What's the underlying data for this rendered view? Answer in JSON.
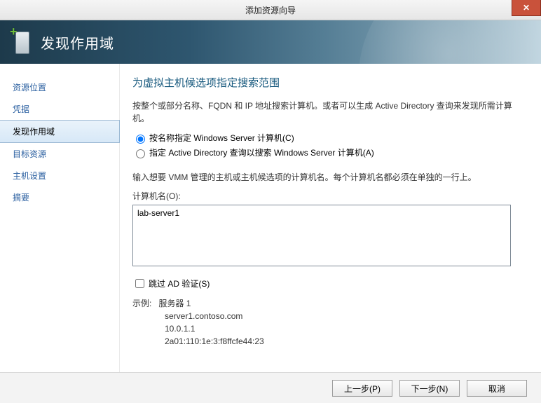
{
  "window": {
    "title": "添加资源向导"
  },
  "header": {
    "title": "发现作用域"
  },
  "sidebar": {
    "items": [
      {
        "label": "资源位置"
      },
      {
        "label": "凭据"
      },
      {
        "label": "发现作用域"
      },
      {
        "label": "目标资源"
      },
      {
        "label": "主机设置"
      },
      {
        "label": "摘要"
      }
    ],
    "active_index": 2
  },
  "content": {
    "section_title": "为虚拟主机候选项指定搜索范围",
    "description": "按整个或部分名称、FQDN 和 IP 地址搜索计算机。或者可以生成 Active Directory 查询来发现所需计算机。",
    "radio": {
      "by_name": "按名称指定 Windows Server 计算机(C)",
      "by_ad": "指定 Active Directory 查询以搜索 Windows Server 计算机(A)",
      "selected": "by_name"
    },
    "instruction": "输入想要 VMM 管理的主机或主机候选项的计算机名。每个计算机名都必须在单独的一行上。",
    "computer_label": "计算机名(O):",
    "computer_value": "lab-server1",
    "skip_ad": {
      "label": "跳过 AD 验证(S)",
      "checked": false
    },
    "example": {
      "label": "示例:",
      "title": "服务器 1",
      "lines": [
        "server1.contoso.com",
        "10.0.1.1",
        "2a01:110:1e:3:f8ffcfe44:23"
      ]
    }
  },
  "buttons": {
    "prev": "上一步(P)",
    "next": "下一步(N)",
    "cancel": "取消"
  }
}
